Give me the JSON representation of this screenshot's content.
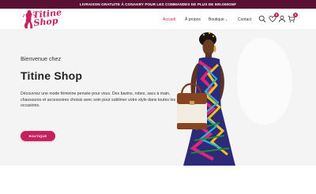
{
  "topbar": {
    "text": "LIVRAISON GRATUITE À CONAKRY POUR LES COMMANDES DE PLUS DE 500.000GNF"
  },
  "logo": {
    "text": "Titine\nShop"
  },
  "nav": {
    "items": [
      {
        "label": "Accueil",
        "active": true
      },
      {
        "label": "À propos"
      },
      {
        "label": "Boutique",
        "has_dropdown": true
      },
      {
        "label": "Contact"
      }
    ]
  },
  "icons": {
    "search": "search-icon",
    "wishlist": {
      "name": "heart-icon",
      "count": "0"
    },
    "account": "user-icon",
    "cart": {
      "name": "cart-icon",
      "count": "0"
    }
  },
  "hero": {
    "subtitle": "Bienvenue chez",
    "title": "Titine Shop",
    "description": "Découvrez une mode féminine pensée pour vous. Des bazins, robes, sacs à main, chaussures et accessoires choisis avec soin pour sublimer votre style dans toutes les occasions.",
    "button": "BOUTIQUE"
  },
  "colors": {
    "accent": "#c8205f",
    "topbar": "#5a1033",
    "hero_bg": "#f4f4f4"
  }
}
